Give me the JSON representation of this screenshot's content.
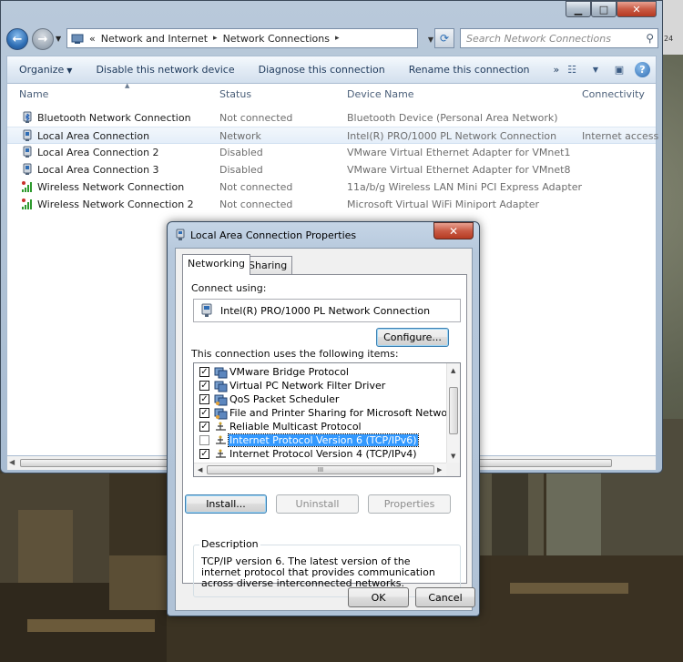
{
  "explorer": {
    "caption": {
      "minimize": "▁",
      "maximize": "□",
      "close": "✕"
    },
    "address": {
      "crumbs": [
        "Network and Internet",
        "Network Connections"
      ],
      "leading": "«",
      "separator": "▸"
    },
    "search": {
      "placeholder": "Search Network Connections"
    },
    "commandbar": {
      "organize": "Organize",
      "disable": "Disable this network device",
      "diagnose": "Diagnose this connection",
      "rename": "Rename this connection",
      "more": "»"
    },
    "columns": {
      "name": "Name",
      "status": "Status",
      "device": "Device Name",
      "connectivity": "Connectivity"
    },
    "connections": [
      {
        "name": "Bluetooth Network Connection",
        "status": "Not connected",
        "device": "Bluetooth Device (Personal Area Network)",
        "connectivity": "",
        "icon": "bluetooth-icon"
      },
      {
        "name": "Local Area Connection",
        "status": "Network",
        "device": "Intel(R) PRO/1000 PL Network Connection",
        "connectivity": "Internet access",
        "icon": "ethernet-icon",
        "selected": true
      },
      {
        "name": "Local Area Connection 2",
        "status": "Disabled",
        "device": "VMware Virtual Ethernet Adapter for VMnet1",
        "connectivity": "",
        "icon": "ethernet-icon"
      },
      {
        "name": "Local Area Connection 3",
        "status": "Disabled",
        "device": "VMware Virtual Ethernet Adapter for VMnet8",
        "connectivity": "",
        "icon": "ethernet-icon"
      },
      {
        "name": "Wireless Network Connection",
        "status": "Not connected",
        "device": "11a/b/g Wireless LAN Mini PCI Express Adapter",
        "connectivity": "",
        "icon": "wireless-icon"
      },
      {
        "name": "Wireless Network Connection 2",
        "status": "Not connected",
        "device": "Microsoft Virtual WiFi Miniport Adapter",
        "connectivity": "",
        "icon": "wireless-icon"
      }
    ]
  },
  "dialog": {
    "title": "Local Area Connection Properties",
    "close": "✕",
    "tabs": [
      "Networking",
      "Sharing"
    ],
    "connect_using_label": "Connect using:",
    "adapter": "Intel(R) PRO/1000 PL Network Connection",
    "configure": "Configure...",
    "items_label": "This connection uses the following items:",
    "items": [
      {
        "label": "VMware Bridge Protocol",
        "checked": true,
        "icon": "network-client-icon"
      },
      {
        "label": "Virtual PC Network Filter Driver",
        "checked": true,
        "icon": "network-client-icon"
      },
      {
        "label": "QoS Packet Scheduler",
        "checked": true,
        "icon": "network-service-icon"
      },
      {
        "label": "File and Printer Sharing for Microsoft Networks",
        "checked": true,
        "icon": "network-service-icon"
      },
      {
        "label": "Reliable Multicast Protocol",
        "checked": true,
        "icon": "protocol-icon"
      },
      {
        "label": "Internet Protocol Version 6 (TCP/IPv6)",
        "checked": false,
        "icon": "protocol-icon",
        "selected": true
      },
      {
        "label": "Internet Protocol Version 4 (TCP/IPv4)",
        "checked": true,
        "icon": "protocol-icon"
      }
    ],
    "scroll_grip": "III",
    "install": "Install...",
    "uninstall": "Uninstall",
    "properties": "Properties",
    "description_label": "Description",
    "description": "TCP/IP version 6. The latest version of the internet protocol that provides communication across diverse interconnected networks.",
    "ok": "OK",
    "cancel": "Cancel"
  },
  "desktop": {
    "tray_label": "24"
  }
}
